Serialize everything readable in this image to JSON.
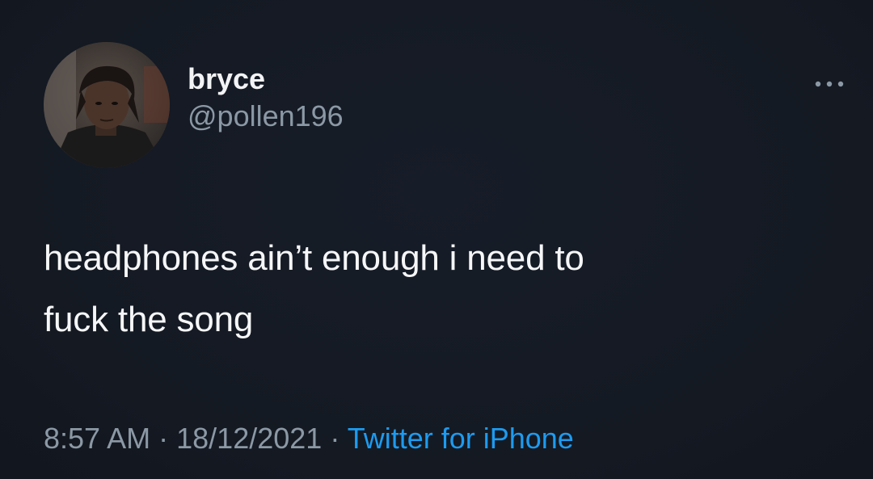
{
  "tweet": {
    "author": {
      "display_name": "bryce",
      "handle": "@pollen196"
    },
    "more_icon": "more-horizontal-icon",
    "text_line1": "headphones ain’t enough i need to",
    "text_line2": "fuck the song",
    "time": "8:57 AM",
    "separator": "·",
    "date": "18/12/2021",
    "source": "Twitter for iPhone"
  },
  "colors": {
    "background": "#151a24",
    "primary_text": "#f5f6f7",
    "secondary_text": "#8b98a5",
    "link": "#1d9bf0"
  }
}
